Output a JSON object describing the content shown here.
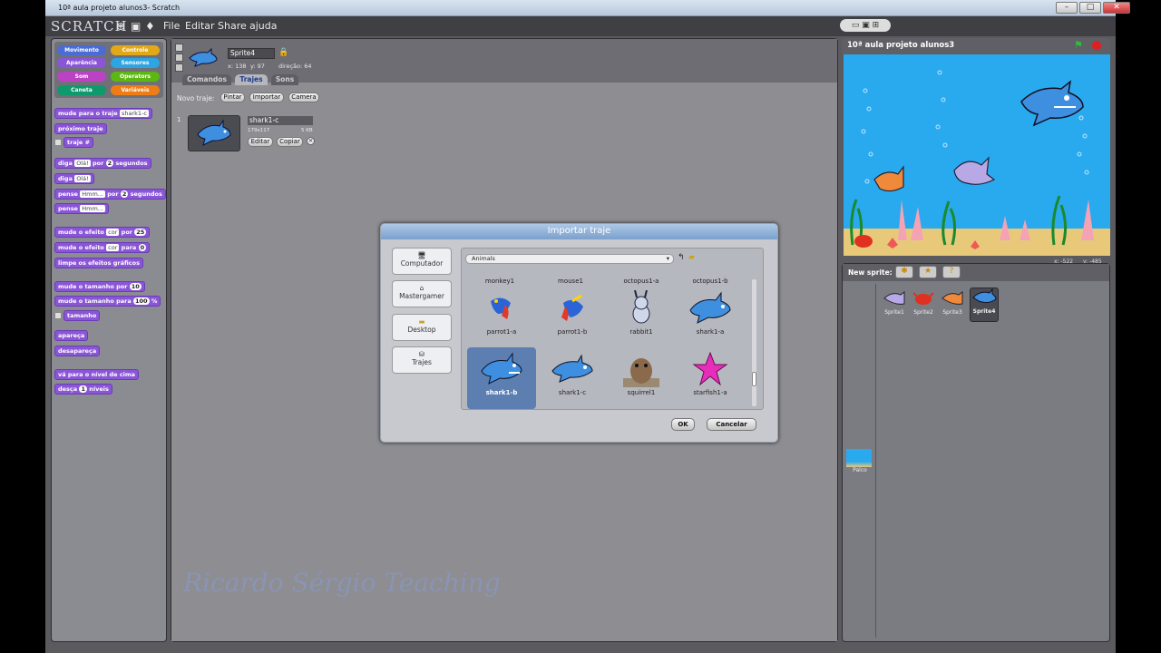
{
  "window": {
    "title": "10ª aula projeto alunos3- Scratch"
  },
  "menu": {
    "logo": "SCRATCH",
    "items": [
      "File",
      "Editar",
      "Share",
      "ajuda"
    ]
  },
  "categories": [
    "Movimento",
    "Controle",
    "Aparência",
    "Sensores",
    "Som",
    "Operators",
    "Caneta",
    "Variáveis"
  ],
  "blocks": {
    "b1": "mude para o traje",
    "b1v": "shark1-c",
    "b2": "próximo traje",
    "b3": "traje #",
    "b4a": "diga",
    "b4b": "Olá!",
    "b4c": "por",
    "b4d": "2",
    "b4e": "segundos",
    "b5a": "diga",
    "b5b": "Olá!",
    "b6a": "pense",
    "b6b": "Hmm...",
    "b6c": "por",
    "b6d": "2",
    "b6e": "segundos",
    "b7a": "pense",
    "b7b": "Hmm...",
    "b8a": "mude o efeito",
    "b8b": "cor",
    "b8c": "por",
    "b8d": "25",
    "b9a": "mude o efeito",
    "b9b": "cor",
    "b9c": "para",
    "b9d": "0",
    "b10": "limpe os efeitos gráficos",
    "b11a": "mude o tamanho por",
    "b11b": "10",
    "b12a": "mude o tamanho para",
    "b12b": "100",
    "b12c": "%",
    "b13": "tamanho",
    "b14": "apareça",
    "b15": "desapareça",
    "b16": "vá para o nível de cima",
    "b17a": "desça",
    "b17b": "1",
    "b17c": "níveis"
  },
  "sprite": {
    "name": "Sprite4",
    "x": "x: 138",
    "y": "y: 97",
    "direction": "direção: 64"
  },
  "tabs": [
    "Comandos",
    "Trajes",
    "Sons"
  ],
  "costumes": {
    "new_label": "Novo traje:",
    "paint": "Pintar",
    "import": "Importar",
    "camera": "Camera",
    "index": "1",
    "name": "shark1-c",
    "size": "179x117",
    "kb": "5 KB",
    "edit": "Editar",
    "copy": "Copiar"
  },
  "stage": {
    "title": "10ª aula projeto alunos3",
    "mouse_x": "x: -522",
    "mouse_y": "y: -485"
  },
  "new_sprite": "New sprite:",
  "sprites": [
    "Sprite1",
    "Sprite2",
    "Sprite3",
    "Sprite4"
  ],
  "stage_thumb": "Palco",
  "dialog": {
    "title": "Importar traje",
    "sidebar": [
      "Computador",
      "Mastergamer",
      "Desktop",
      "Trajes"
    ],
    "folder": "Animals",
    "top_row": [
      "monkey1",
      "mouse1",
      "octopus1-a",
      "octopus1-b"
    ],
    "items": [
      "parrot1-a",
      "parrot1-b",
      "rabbit1",
      "shark1-a",
      "shark1-b",
      "shark1-c",
      "squirrel1",
      "starfish1-a"
    ],
    "ok": "OK",
    "cancel": "Cancelar"
  },
  "watermark": "Ricardo Sérgio Teaching",
  "colors": {
    "looks": "#8a55d7",
    "motion": "#4a6cd4",
    "control": "#e1a91a",
    "sound": "#bb42c3",
    "sensing": "#2ca5e2",
    "pen": "#0e9a6c",
    "operators": "#5cb712",
    "variables": "#ee7d16",
    "selected": "#5c7eb1"
  }
}
